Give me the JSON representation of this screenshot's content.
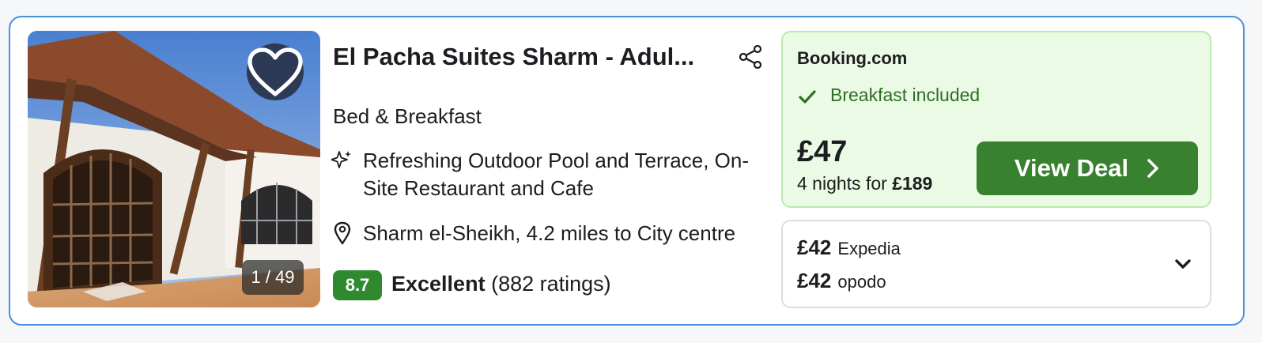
{
  "hotel": {
    "name": "El Pacha Suites Sharm - Adul...",
    "type": "Bed & Breakfast",
    "amenities": "Refreshing Outdoor Pool and Terrace, On-Site Restaurant and Cafe",
    "location": "Sharm el-Sheikh, 4.2 miles to City centre",
    "photo_counter": "1 / 49",
    "rating": {
      "score": "8.7",
      "word": "Excellent",
      "count": "(882 ratings)"
    }
  },
  "deal": {
    "provider": "Booking.com",
    "perk": "Breakfast included",
    "price": "£47",
    "nights_prefix": "4 nights for",
    "total": "£189",
    "button_label": "View Deal"
  },
  "other_offers": [
    {
      "price": "£42",
      "provider": "Expedia"
    },
    {
      "price": "£42",
      "provider": "opodo"
    }
  ],
  "icons": {
    "favorite": "heart-icon",
    "share": "share-icon",
    "amenities": "sparkle-icon",
    "location": "map-pin-icon",
    "perk": "check-icon",
    "cta": "chevron-right-icon",
    "expand": "chevron-down-icon"
  },
  "colors": {
    "card_border": "#4a90d9",
    "rating_badge": "#2f8a2f",
    "deal_background": "#ebfae5",
    "deal_border": "#b7ebab",
    "cta_button": "#38812e",
    "perk_text": "#2e6e24"
  }
}
